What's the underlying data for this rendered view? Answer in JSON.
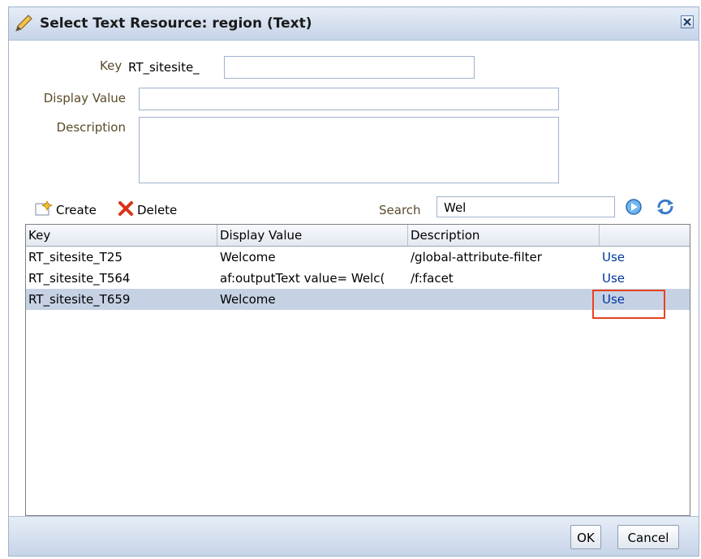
{
  "dialog": {
    "title": "Select Text Resource: region (Text)",
    "close_icon": "close-icon"
  },
  "form": {
    "key_label": "Key",
    "key_prefix": "RT_sitesite_",
    "key_value": "",
    "display_value_label": "Display Value",
    "display_value_value": "",
    "description_label": "Description",
    "description_value": ""
  },
  "toolbar": {
    "create_label": "Create",
    "delete_label": "Delete",
    "search_label": "Search",
    "search_value": "Wel"
  },
  "table": {
    "columns": [
      "Key",
      "Display Value",
      "Description",
      ""
    ],
    "rows": [
      {
        "key": "RT_sitesite_T25",
        "display": "Welcome",
        "description": "/global-attribute-filter",
        "action": "Use"
      },
      {
        "key": "RT_sitesite_T564",
        "display": "af:outputText value= Welc(",
        "description": "/f:facet",
        "action": "Use"
      },
      {
        "key": "RT_sitesite_T659",
        "display": "Welcome",
        "description": "",
        "action": "Use"
      }
    ],
    "selected_row": 2
  },
  "footer": {
    "ok_label": "OK",
    "cancel_label": "Cancel"
  },
  "colors": {
    "selection": "#c6d2e4",
    "highlight_box": "#e8431f",
    "link": "#00379e"
  }
}
